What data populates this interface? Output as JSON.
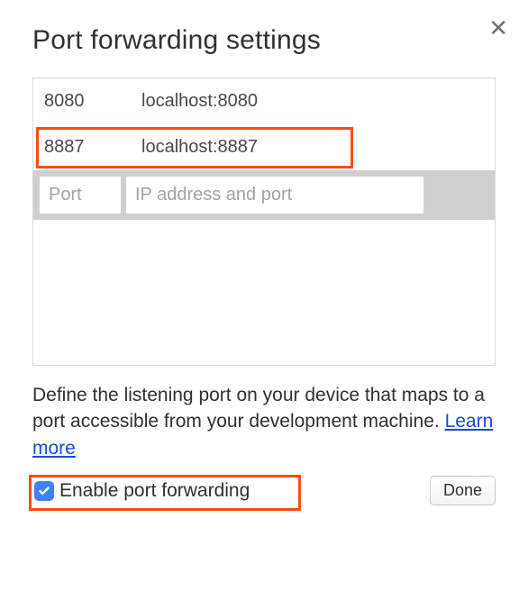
{
  "title": "Port forwarding settings",
  "rows": [
    {
      "port": "8080",
      "addr": "localhost:8080"
    },
    {
      "port": "8887",
      "addr": "localhost:8887"
    }
  ],
  "input": {
    "port_placeholder": "Port",
    "addr_placeholder": "IP address and port"
  },
  "description": {
    "text": "Define the listening port on your device that maps to a port accessible from your development machine. ",
    "link": "Learn more"
  },
  "enable_label": "Enable port forwarding",
  "done_label": "Done"
}
